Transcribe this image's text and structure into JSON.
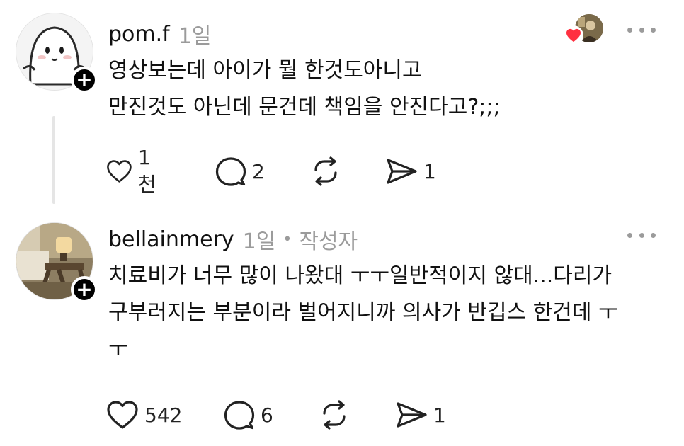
{
  "posts": [
    {
      "username": "pom.f",
      "time": "1일",
      "body": "영상보는데 아이가 뭘 한것도아니고\n만진것도 아닌데 문건데 책임을 안진다고?;;;",
      "likes": "1천",
      "comments": "2",
      "reposts": "",
      "shares": "1"
    },
    {
      "username": "bellainmery",
      "time": "1일",
      "separator": "•",
      "author_tag": "작성자",
      "body": "치료비가 너무 많이 나왔대 ㅜㅜ일반적이지 않대...다리가\n구부러지는 부분이라 벌어지니까 의사가 반깁스 한건데 ㅜ\nㅜ",
      "likes": "542",
      "comments": "6",
      "reposts": "",
      "shares": "1"
    }
  ],
  "icons": {
    "follow": "+",
    "heart": "heart-icon",
    "comment": "comment-icon",
    "repost": "repost-icon",
    "share": "share-icon",
    "more": "more-icon"
  },
  "colors": {
    "accent_heart": "#ff3040",
    "muted": "#9b9b9b",
    "text": "#111111"
  }
}
